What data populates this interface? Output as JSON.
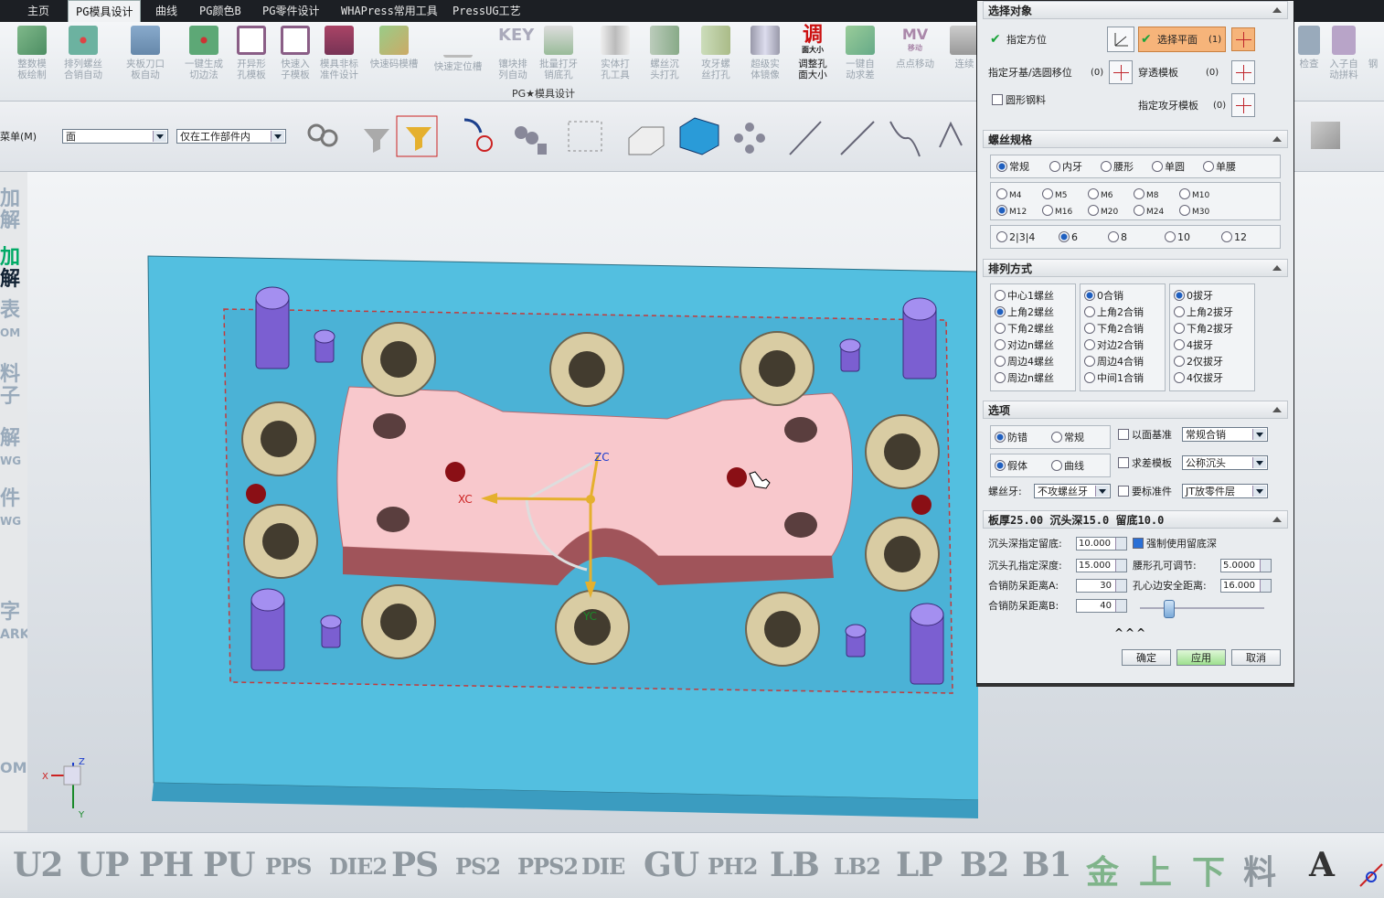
{
  "tabs": [
    {
      "label": "主页"
    },
    {
      "label": "PG模具设计",
      "active": true
    },
    {
      "label": "曲线"
    },
    {
      "label": "PG颜色B"
    },
    {
      "label": "PG零件设计"
    },
    {
      "label": "WHAPress常用工具"
    },
    {
      "label": "PressUG工艺"
    }
  ],
  "ribbon": {
    "group_label": "PG★模具设计",
    "items": [
      {
        "label": "整数模\n板绘制"
      },
      {
        "label": "排列螺丝\n合销自动"
      },
      {
        "label": "夹板刀口\n板自动"
      },
      {
        "label": "一键生成\n切边法"
      },
      {
        "label": "开异形\n孔模板"
      },
      {
        "label": "快速入\n子模板"
      },
      {
        "label": "模具非标\n准件设计"
      },
      {
        "label": "快速码模槽"
      },
      {
        "label": "快速定位槽"
      },
      {
        "label": "镶块排\n列自动"
      },
      {
        "label": "批量打牙\n销底孔"
      },
      {
        "label": "实体打\n孔工具"
      },
      {
        "label": "螺丝沉\n头打孔"
      },
      {
        "label": "攻牙螺\n丝打孔"
      },
      {
        "label": "超级实\n体镜像"
      },
      {
        "label": "调整孔\n面大小",
        "icon_text": "调",
        "icon_sub": "面大小"
      },
      {
        "label": "一键自\n动求差"
      },
      {
        "label": "点点移动",
        "icon_text": "MV",
        "icon_sub": "移动"
      },
      {
        "label": "连续"
      }
    ],
    "right_items": [
      {
        "label": "检查"
      },
      {
        "label": "入子自\n动拼料"
      },
      {
        "label": "钢"
      }
    ]
  },
  "toolbar2": {
    "menu_label": "菜单(M)",
    "filter_select": "面",
    "scope_select": "仅在工作部件内"
  },
  "left_strip": [
    "加",
    "解",
    "加",
    "解",
    "表",
    "OM",
    "料",
    "子",
    "解",
    "WG",
    "件",
    "WG",
    "字",
    "ARK",
    "OM"
  ],
  "viewport": {
    "axis_xc": "XC",
    "axis_yc": "YC",
    "axis_zc": "ZC",
    "triad_x": "X",
    "triad_y": "Y",
    "triad_z": "Z"
  },
  "bottom_bar": [
    "U2",
    "UP",
    "PH",
    "PU",
    "PPS",
    "DIE2",
    "PS",
    "PS2",
    "PPS2",
    "DIE",
    "GU",
    "PH2",
    "LB",
    "LB2",
    "LP",
    "B2",
    "B1",
    "金",
    "上",
    "下",
    "料",
    "A"
  ],
  "dialog": {
    "sections": {
      "select_object": "选择对象",
      "screw_spec": "螺丝规格",
      "arrangement": "排列方式",
      "options": "选项",
      "thickness": "板厚25.00 沉头深15.0 留底10.0"
    },
    "select": {
      "specify_orient": "指定方位",
      "select_plane": "选择平面",
      "select_plane_count": "(1)",
      "specify_base": "指定牙基/选圆移位",
      "base_count": "(0)",
      "through_template": "穿透模板",
      "through_count": "(0)",
      "round_steel": "圆形钢料",
      "tap_template": "指定攻牙模板",
      "tap_count": "(0)"
    },
    "spec_types": [
      {
        "label": "常规",
        "on": true
      },
      {
        "label": "内牙"
      },
      {
        "label": "腰形"
      },
      {
        "label": "单圆"
      },
      {
        "label": "单腰"
      }
    ],
    "sizes": [
      {
        "label": "M4"
      },
      {
        "label": "M5"
      },
      {
        "label": "M6"
      },
      {
        "label": "M8"
      },
      {
        "label": "M10"
      },
      {
        "label": "M12",
        "on": true
      },
      {
        "label": "M16"
      },
      {
        "label": "M20"
      },
      {
        "label": "M24"
      },
      {
        "label": "M30"
      }
    ],
    "counts": [
      {
        "label": "2|3|4"
      },
      {
        "label": "6",
        "on": true
      },
      {
        "label": "8"
      },
      {
        "label": "10"
      },
      {
        "label": "12"
      }
    ],
    "arrange_col1": [
      {
        "label": "中心1螺丝"
      },
      {
        "label": "上角2螺丝",
        "on": true
      },
      {
        "label": "下角2螺丝"
      },
      {
        "label": "对边n螺丝"
      },
      {
        "label": "周边4螺丝"
      },
      {
        "label": "周边n螺丝"
      }
    ],
    "arrange_col2": [
      {
        "label": "0合销",
        "on": true
      },
      {
        "label": "上角2合销"
      },
      {
        "label": "下角2合销"
      },
      {
        "label": "对边2合销"
      },
      {
        "label": "周边4合销"
      },
      {
        "label": "中间1合销"
      }
    ],
    "arrange_col3": [
      {
        "label": "0拔牙",
        "on": true
      },
      {
        "label": "上角2拔牙"
      },
      {
        "label": "下角2拔牙"
      },
      {
        "label": "4拔牙"
      },
      {
        "label": "2仅拔牙"
      },
      {
        "label": "4仅拔牙"
      }
    ],
    "options": {
      "anti_err": "防错",
      "normal": "常规",
      "false_body": "假体",
      "curve": "曲线",
      "face_datum": "以面基准",
      "face_datum_sel": "常规合销",
      "diff_template": "求差模板",
      "diff_sel": "公称沉头",
      "screw_tooth": "螺丝牙:",
      "screw_tooth_sel": "不攻螺丝牙",
      "std_part": "要标准件",
      "std_sel": "JT放零件层"
    },
    "params": {
      "sink_bottom_label": "沉头深指定留底:",
      "sink_bottom_val": "10.000",
      "force_bottom": "强制使用留底深",
      "sink_depth_label": "沉头孔指定深度:",
      "sink_depth_val": "15.000",
      "slot_adj_label": "腰形孔可调节:",
      "slot_adj_val": "5.0000",
      "pin_a_label": "合销防呆距离A:",
      "pin_a_val": "30",
      "edge_safe_label": "孔心边安全距离:",
      "edge_safe_val": "16.000",
      "pin_b_label": "合销防呆距离B:",
      "pin_b_val": "40"
    },
    "buttons": {
      "ok": "确定",
      "apply": "应用",
      "cancel": "取消"
    }
  }
}
